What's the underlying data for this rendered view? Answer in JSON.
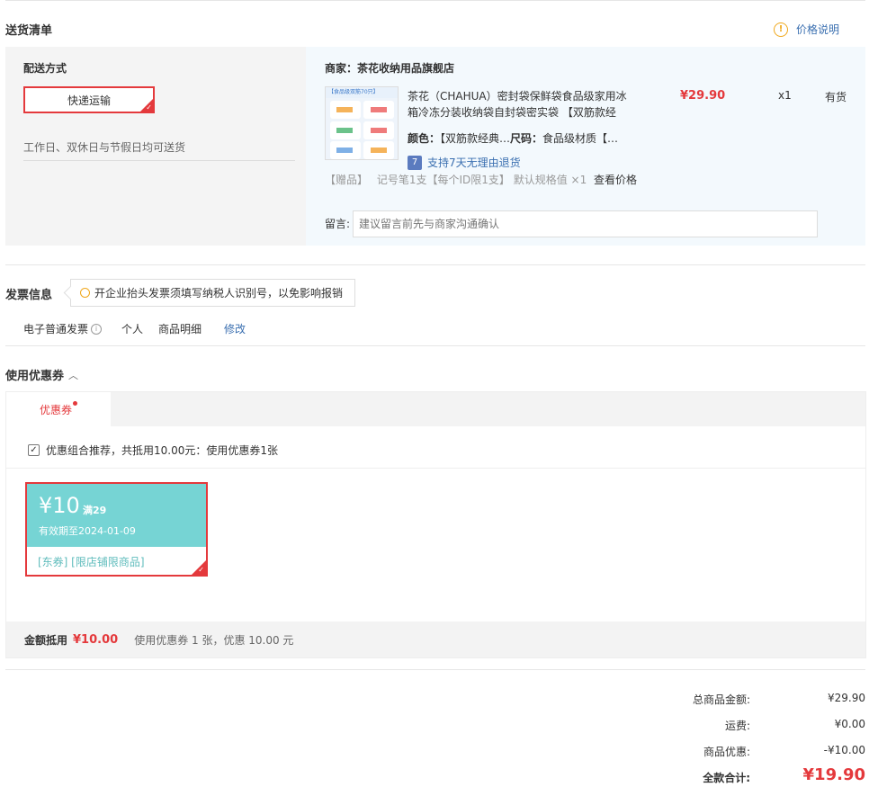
{
  "header": {
    "title": "送货清单",
    "price_note": "价格说明"
  },
  "shipping": {
    "method_label": "配送方式",
    "method_button": "快递运输",
    "delivery_time": "工作日、双休日与节假日均可送货"
  },
  "shop": {
    "label": "商家：",
    "name": "茶花收纳用品旗舰店"
  },
  "product": {
    "title_line1": "茶花（CHAHUA）密封袋保鲜袋食品级家用冰",
    "title_line2": "箱冷冻分装收纳袋自封袋密实袋 【双筋款经",
    "price": "¥29.90",
    "qty": "x1",
    "stock": "有货",
    "color_label": "颜色：",
    "color_value": "【双筋款经典…",
    "size_label": "尺码：",
    "size_value": "食品级材质【…",
    "return_badge": "7",
    "return_text": "支持7天无理由退货",
    "thumb_banner": "【食品级双筋70只】",
    "gift_tag": "【赠品】",
    "gift_text": "记号笔1支【每个ID限1支】 默认规格值 ×1",
    "gift_link": "查看价格"
  },
  "note": {
    "label": "留言:",
    "placeholder": "建议留言前先与商家沟通确认"
  },
  "invoice": {
    "title": "发票信息",
    "tip": "开企业抬头发票须填写纳税人识别号，以免影响报销",
    "type": "电子普通发票",
    "info_icon": "i",
    "person": "个人",
    "content": "商品明细",
    "edit": "修改"
  },
  "coupons": {
    "title": "使用优惠券",
    "tab": "优惠券",
    "combo_text": "优惠组合推荐，共抵用10.00元：使用优惠券1张",
    "card": {
      "amount": "¥10",
      "condition": "满29",
      "expiry": "有效期至2024-01-09",
      "tags": "[东券] [限店铺限商品]"
    },
    "summary_label": "金额抵用",
    "summary_amount": "¥10.00",
    "summary_text": "使用优惠券 1 张，优惠 10.00 元"
  },
  "totals": {
    "items": [
      {
        "label": "总商品金额:",
        "value": "¥29.90"
      },
      {
        "label": "运费:",
        "value": "¥0.00"
      },
      {
        "label": "商品优惠:",
        "value": "-¥10.00"
      }
    ],
    "grand_label": "全款合计:",
    "grand_value": "¥19.90"
  },
  "colors": {
    "accent_red": "#e4393c",
    "coupon_teal": "#76d4d4",
    "link_blue": "#3a6fb0"
  }
}
